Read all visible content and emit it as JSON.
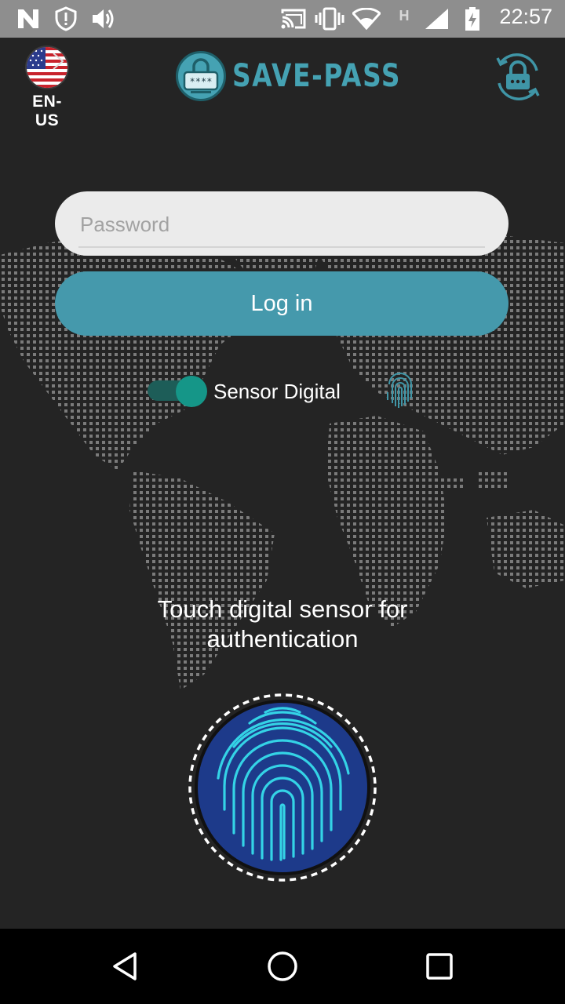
{
  "status_bar": {
    "time": "22:57",
    "network_type": "H",
    "icons": [
      "n-icon",
      "shield-alert-icon",
      "volume-icon",
      "cast-icon",
      "vibrate-icon",
      "wifi-icon",
      "network-type-icon",
      "signal-icon",
      "battery-charging-icon"
    ]
  },
  "header": {
    "language": "EN-US",
    "brand_name": "SAVE-PASS",
    "logo_text": "****"
  },
  "form": {
    "password_placeholder": "Password",
    "password_value": "",
    "login_label": "Log in"
  },
  "sensor": {
    "toggle_label": "Sensor Digital",
    "enabled": true
  },
  "prompt": {
    "line1": "Touch digital sensor for",
    "line2": "authentication"
  },
  "nav": {
    "buttons": [
      "back-icon",
      "home-icon",
      "recents-icon"
    ]
  },
  "colors": {
    "accent": "#4599ac",
    "toggle": "#159688",
    "background": "#242424",
    "fingerprint_bg": "#1d3a8a",
    "fingerprint_lines": "#34d3e6"
  }
}
